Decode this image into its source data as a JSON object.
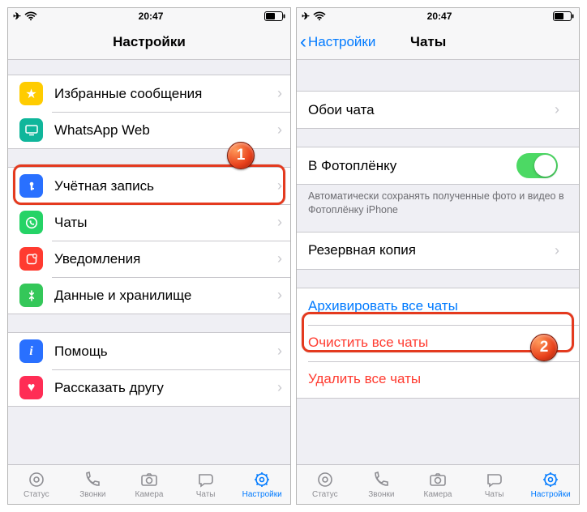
{
  "status": {
    "time": "20:47"
  },
  "left": {
    "title": "Настройки",
    "group1": [
      {
        "icon": "star",
        "color": "#ffcc00",
        "label": "Избранные сообщения"
      },
      {
        "icon": "desktop",
        "color": "#10b69b",
        "label": "WhatsApp Web"
      }
    ],
    "group2": [
      {
        "icon": "key",
        "color": "#2970ff",
        "label": "Учётная запись"
      },
      {
        "icon": "whatsapp",
        "color": "#25d366",
        "label": "Чаты"
      },
      {
        "icon": "bell",
        "color": "#ff3b30",
        "label": "Уведомления"
      },
      {
        "icon": "data",
        "color": "#34c759",
        "label": "Данные и хранилище"
      }
    ],
    "group3": [
      {
        "icon": "info",
        "color": "#2970ff",
        "label": "Помощь"
      },
      {
        "icon": "heart",
        "color": "#ff2d55",
        "label": "Рассказать другу"
      }
    ]
  },
  "right": {
    "back": "Настройки",
    "title": "Чаты",
    "wallpaper": "Обои чата",
    "cameraRoll": "В Фотоплёнку",
    "cameraRollNote": "Автоматически сохранять полученные фото и видео в Фотоплёнку iPhone",
    "backup": "Резервная копия",
    "archive": "Архивировать все чаты",
    "clear": "Очистить все чаты",
    "delete": "Удалить все чаты"
  },
  "tabs": {
    "status": "Статус",
    "calls": "Звонки",
    "camera": "Камера",
    "chats": "Чаты",
    "settings": "Настройки"
  },
  "callouts": {
    "one": "1",
    "two": "2"
  }
}
